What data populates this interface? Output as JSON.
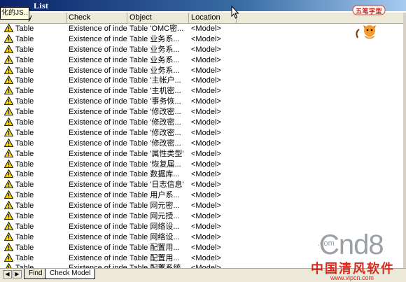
{
  "window": {
    "title": "List"
  },
  "tooltip": {
    "text": "化的JS…"
  },
  "columns": {
    "type": "y",
    "check": "Check",
    "object": "Object",
    "location": "Location"
  },
  "rows": [
    {
      "type": "Table",
      "check": "Existence of index",
      "object": "Table 'OMC密...",
      "location": "<Model>"
    },
    {
      "type": "Table",
      "check": "Existence of index",
      "object": "Table 业务系...",
      "location": "<Model>"
    },
    {
      "type": "Table",
      "check": "Existence of index",
      "object": "Table 业务系...",
      "location": "<Model>"
    },
    {
      "type": "Table",
      "check": "Existence of index",
      "object": "Table 业务系...",
      "location": "<Model>"
    },
    {
      "type": "Table",
      "check": "Existence of index",
      "object": "Table 业务系...",
      "location": "<Model>"
    },
    {
      "type": "Table",
      "check": "Existence of index",
      "object": "Table '主帐户...",
      "location": "<Model>"
    },
    {
      "type": "Table",
      "check": "Existence of index",
      "object": "Table '主机密...",
      "location": "<Model>"
    },
    {
      "type": "Table",
      "check": "Existence of index",
      "object": "Table '事务恢...",
      "location": "<Model>"
    },
    {
      "type": "Table",
      "check": "Existence of index",
      "object": "Table '修改密...",
      "location": "<Model>"
    },
    {
      "type": "Table",
      "check": "Existence of index",
      "object": "Table '修改密...",
      "location": "<Model>"
    },
    {
      "type": "Table",
      "check": "Existence of index",
      "object": "Table '修改密...",
      "location": "<Model>"
    },
    {
      "type": "Table",
      "check": "Existence of index",
      "object": "Table '修改密...",
      "location": "<Model>"
    },
    {
      "type": "Table",
      "check": "Existence of index",
      "object": "Table '属性类型'",
      "location": "<Model>"
    },
    {
      "type": "Table",
      "check": "Existence of index",
      "object": "Table '恢复届...",
      "location": "<Model>"
    },
    {
      "type": "Table",
      "check": "Existence of index",
      "object": "Table 数据库...",
      "location": "<Model>"
    },
    {
      "type": "Table",
      "check": "Existence of index",
      "object": "Table '日志信息'",
      "location": "<Model>"
    },
    {
      "type": "Table",
      "check": "Existence of index",
      "object": "Table 用户系...",
      "location": "<Model>"
    },
    {
      "type": "Table",
      "check": "Existence of index",
      "object": "Table 网元密...",
      "location": "<Model>"
    },
    {
      "type": "Table",
      "check": "Existence of index",
      "object": "Table 网元授...",
      "location": "<Model>"
    },
    {
      "type": "Table",
      "check": "Existence of index",
      "object": "Table 网络设...",
      "location": "<Model>"
    },
    {
      "type": "Table",
      "check": "Existence of index",
      "object": "Table 网络设...",
      "location": "<Model>"
    },
    {
      "type": "Table",
      "check": "Existence of index",
      "object": "Table 配置用...",
      "location": "<Model>"
    },
    {
      "type": "Table",
      "check": "Existence of index",
      "object": "Table 配置用...",
      "location": "<Model>"
    },
    {
      "type": "Table",
      "check": "Existence of index",
      "object": "Table 配置系统",
      "location": "<Model>"
    }
  ],
  "tabs": [
    {
      "label": "Find"
    },
    {
      "label": "Check Model"
    }
  ],
  "mascot": {
    "label": "五笔字型"
  },
  "watermark": {
    "brand": "Cnd8",
    "dotcom": ".com",
    "cn": "中国清风软件",
    "url": "www.vipcn.com"
  },
  "colors": {
    "titlebar": "#0a246a",
    "warning": "#f5d300",
    "watermark_red": "#d62a1e"
  },
  "icons": {
    "warning": "warning-triangle-icon",
    "nav_left": "arrow-left-icon",
    "nav_right": "arrow-right-icon"
  }
}
